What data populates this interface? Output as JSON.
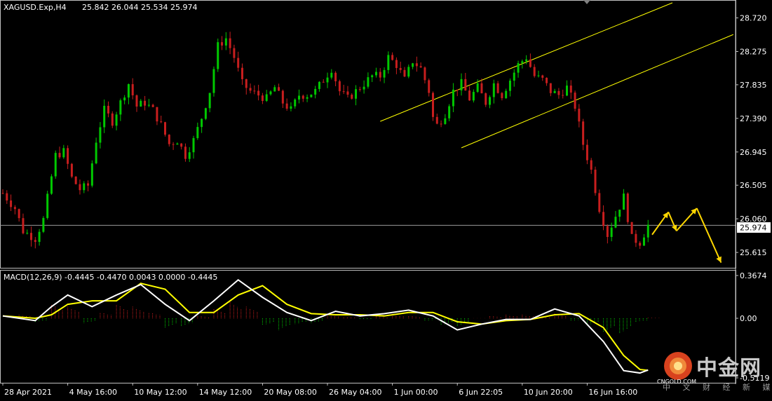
{
  "header": {
    "symbol_tf": "XAGUSD.Exp,H4",
    "ohlc": "25.842 26.044 25.534 25.974"
  },
  "price_axis": {
    "ticks": [
      "28.720",
      "28.275",
      "27.835",
      "27.390",
      "26.945",
      "26.505",
      "26.060",
      "25.615"
    ],
    "current_price": "25.974"
  },
  "macd": {
    "header": "MACD(12,26,9) -0.4445 -0.4470 0.0043 0.0000 -0.4445",
    "ticks": [
      "0.3674",
      "0.00",
      "-0.5119"
    ]
  },
  "time_axis": {
    "labels": [
      "28 Apr 2021",
      "4 May 16:00",
      "10 May 12:00",
      "14 May 12:00",
      "20 May 08:00",
      "26 May 04:00",
      "1 Jun 00:00",
      "6 Jun 22:05",
      "10 Jun 20:00",
      "16 Jun 16:00"
    ]
  },
  "watermark": {
    "name": "中金网",
    "url": "CNGOLD.COM",
    "sub": "中 文 财 经 新 媒 体"
  },
  "colors": {
    "background": "#000000",
    "bull": "#00c800",
    "bear": "#c81e1e",
    "channel": "#ffff00",
    "macd_line": "#ffffff",
    "signal_line": "#ffff00",
    "projection": "#ffd700",
    "grid": "#c0c0c0"
  },
  "chart_data": {
    "type": "candlestick",
    "symbol": "XAGUSD.Exp",
    "timeframe": "H4",
    "current_price": 25.974,
    "last_bar": {
      "open": 25.842,
      "high": 26.044,
      "low": 25.534,
      "close": 25.974
    },
    "y_range": [
      25.43,
      28.92
    ],
    "close_path": [
      {
        "t": 0,
        "c": 26.4
      },
      {
        "t": 3,
        "c": 26.2
      },
      {
        "t": 5,
        "c": 25.9
      },
      {
        "t": 8,
        "c": 25.8
      },
      {
        "t": 10,
        "c": 26.05
      },
      {
        "t": 13,
        "c": 26.9
      },
      {
        "t": 15,
        "c": 26.95
      },
      {
        "t": 17,
        "c": 26.6
      },
      {
        "t": 19,
        "c": 26.45
      },
      {
        "t": 21,
        "c": 26.5
      },
      {
        "t": 23,
        "c": 27.1
      },
      {
        "t": 25,
        "c": 27.5
      },
      {
        "t": 27,
        "c": 27.35
      },
      {
        "t": 29,
        "c": 27.6
      },
      {
        "t": 31,
        "c": 27.85
      },
      {
        "t": 33,
        "c": 27.55
      },
      {
        "t": 35,
        "c": 27.6
      },
      {
        "t": 37,
        "c": 27.5
      },
      {
        "t": 39,
        "c": 27.3
      },
      {
        "t": 41,
        "c": 27.05
      },
      {
        "t": 43,
        "c": 27.1
      },
      {
        "t": 45,
        "c": 26.9
      },
      {
        "t": 47,
        "c": 27.1
      },
      {
        "t": 49,
        "c": 27.4
      },
      {
        "t": 51,
        "c": 27.75
      },
      {
        "t": 53,
        "c": 28.35
      },
      {
        "t": 55,
        "c": 28.45
      },
      {
        "t": 57,
        "c": 28.2
      },
      {
        "t": 59,
        "c": 27.85
      },
      {
        "t": 61,
        "c": 27.75
      },
      {
        "t": 63,
        "c": 27.7
      },
      {
        "t": 65,
        "c": 27.65
      },
      {
        "t": 67,
        "c": 27.8
      },
      {
        "t": 69,
        "c": 27.6
      },
      {
        "t": 71,
        "c": 27.5
      },
      {
        "t": 73,
        "c": 27.7
      },
      {
        "t": 75,
        "c": 27.7
      },
      {
        "t": 77,
        "c": 27.75
      },
      {
        "t": 79,
        "c": 27.9
      },
      {
        "t": 81,
        "c": 28.05
      },
      {
        "t": 83,
        "c": 27.75
      },
      {
        "t": 85,
        "c": 27.65
      },
      {
        "t": 87,
        "c": 27.75
      },
      {
        "t": 89,
        "c": 27.85
      },
      {
        "t": 91,
        "c": 27.95
      },
      {
        "t": 93,
        "c": 27.95
      },
      {
        "t": 95,
        "c": 28.2
      },
      {
        "t": 97,
        "c": 28.1
      },
      {
        "t": 99,
        "c": 27.9
      },
      {
        "t": 101,
        "c": 28.15
      },
      {
        "t": 103,
        "c": 28.05
      },
      {
        "t": 105,
        "c": 27.75
      },
      {
        "t": 106,
        "c": 27.4
      },
      {
        "t": 107,
        "c": 27.3
      },
      {
        "t": 109,
        "c": 27.45
      },
      {
        "t": 111,
        "c": 27.75
      },
      {
        "t": 113,
        "c": 27.85
      },
      {
        "t": 115,
        "c": 27.65
      },
      {
        "t": 117,
        "c": 27.8
      },
      {
        "t": 119,
        "c": 27.6
      },
      {
        "t": 121,
        "c": 27.85
      },
      {
        "t": 123,
        "c": 27.7
      },
      {
        "t": 125,
        "c": 27.9
      },
      {
        "t": 127,
        "c": 28.1
      },
      {
        "t": 129,
        "c": 28.2
      },
      {
        "t": 131,
        "c": 27.95
      },
      {
        "t": 133,
        "c": 27.9
      },
      {
        "t": 135,
        "c": 27.75
      },
      {
        "t": 137,
        "c": 27.7
      },
      {
        "t": 139,
        "c": 27.8
      },
      {
        "t": 141,
        "c": 27.55
      },
      {
        "t": 143,
        "c": 27.05
      },
      {
        "t": 145,
        "c": 26.7
      },
      {
        "t": 147,
        "c": 26.2
      },
      {
        "t": 149,
        "c": 25.85
      },
      {
        "t": 151,
        "c": 26.1
      },
      {
        "t": 153,
        "c": 26.35
      },
      {
        "t": 155,
        "c": 25.8
      },
      {
        "t": 157,
        "c": 25.75
      },
      {
        "t": 159,
        "c": 25.974
      }
    ],
    "channel_upper": [
      {
        "t": 93,
        "c": 27.35
      },
      {
        "t": 165,
        "c": 28.92
      }
    ],
    "channel_lower": [
      {
        "t": 113,
        "c": 27.0
      },
      {
        "t": 180,
        "c": 28.5
      }
    ],
    "projection_path": [
      {
        "t": 160,
        "c": 25.85
      },
      {
        "t": 164,
        "c": 26.15
      },
      {
        "t": 166,
        "c": 25.9
      },
      {
        "t": 171,
        "c": 26.2
      },
      {
        "t": 177,
        "c": 25.48
      }
    ],
    "macd": {
      "y_range": [
        -0.5119,
        0.3674
      ],
      "values": [
        {
          "t": 0,
          "macd": 0.02,
          "signal": 0.02
        },
        {
          "t": 8,
          "macd": -0.02,
          "signal": 0.0
        },
        {
          "t": 12,
          "macd": 0.1,
          "signal": 0.03
        },
        {
          "t": 16,
          "macd": 0.2,
          "signal": 0.12
        },
        {
          "t": 22,
          "macd": 0.1,
          "signal": 0.15
        },
        {
          "t": 28,
          "macd": 0.2,
          "signal": 0.15
        },
        {
          "t": 34,
          "macd": 0.29,
          "signal": 0.3
        },
        {
          "t": 40,
          "macd": 0.12,
          "signal": 0.25
        },
        {
          "t": 46,
          "macd": -0.02,
          "signal": 0.05
        },
        {
          "t": 52,
          "macd": 0.15,
          "signal": 0.05
        },
        {
          "t": 58,
          "macd": 0.33,
          "signal": 0.2
        },
        {
          "t": 64,
          "macd": 0.18,
          "signal": 0.28
        },
        {
          "t": 70,
          "macd": 0.05,
          "signal": 0.12
        },
        {
          "t": 76,
          "macd": -0.02,
          "signal": 0.04
        },
        {
          "t": 82,
          "macd": 0.06,
          "signal": 0.03
        },
        {
          "t": 88,
          "macd": 0.02,
          "signal": 0.03
        },
        {
          "t": 94,
          "macd": 0.04,
          "signal": 0.02
        },
        {
          "t": 100,
          "macd": 0.07,
          "signal": 0.05
        },
        {
          "t": 106,
          "macd": 0.02,
          "signal": 0.05
        },
        {
          "t": 112,
          "macd": -0.1,
          "signal": -0.03
        },
        {
          "t": 118,
          "macd": -0.05,
          "signal": -0.05
        },
        {
          "t": 124,
          "macd": -0.01,
          "signal": -0.02
        },
        {
          "t": 130,
          "macd": -0.01,
          "signal": -0.01
        },
        {
          "t": 136,
          "macd": 0.08,
          "signal": 0.03
        },
        {
          "t": 142,
          "macd": 0.02,
          "signal": 0.04
        },
        {
          "t": 148,
          "macd": -0.2,
          "signal": -0.08
        },
        {
          "t": 153,
          "macd": -0.45,
          "signal": -0.32
        },
        {
          "t": 157,
          "macd": -0.47,
          "signal": -0.44
        },
        {
          "t": 159,
          "macd": -0.4445,
          "signal": -0.447
        }
      ],
      "histogram": [
        {
          "t": 4,
          "v": 0.03
        },
        {
          "t": 8,
          "v": -0.03
        },
        {
          "t": 12,
          "v": 0.12
        },
        {
          "t": 16,
          "v": 0.1
        },
        {
          "t": 20,
          "v": -0.04
        },
        {
          "t": 24,
          "v": 0.05
        },
        {
          "t": 28,
          "v": 0.12
        },
        {
          "t": 32,
          "v": 0.1
        },
        {
          "t": 36,
          "v": 0.05
        },
        {
          "t": 40,
          "v": -0.08
        },
        {
          "t": 44,
          "v": -0.07
        },
        {
          "t": 48,
          "v": 0.02
        },
        {
          "t": 52,
          "v": 0.08
        },
        {
          "t": 56,
          "v": 0.14
        },
        {
          "t": 60,
          "v": 0.1
        },
        {
          "t": 64,
          "v": -0.06
        },
        {
          "t": 68,
          "v": -0.1
        },
        {
          "t": 72,
          "v": -0.05
        },
        {
          "t": 76,
          "v": -0.04
        },
        {
          "t": 80,
          "v": 0.03
        },
        {
          "t": 84,
          "v": 0.01
        },
        {
          "t": 88,
          "v": -0.01
        },
        {
          "t": 92,
          "v": 0.02
        },
        {
          "t": 96,
          "v": 0.03
        },
        {
          "t": 100,
          "v": 0.02
        },
        {
          "t": 104,
          "v": -0.02
        },
        {
          "t": 108,
          "v": -0.06
        },
        {
          "t": 112,
          "v": -0.07
        },
        {
          "t": 116,
          "v": 0.0
        },
        {
          "t": 120,
          "v": 0.02
        },
        {
          "t": 124,
          "v": 0.03
        },
        {
          "t": 128,
          "v": 0.03
        },
        {
          "t": 132,
          "v": 0.02
        },
        {
          "t": 136,
          "v": 0.04
        },
        {
          "t": 140,
          "v": -0.02
        },
        {
          "t": 144,
          "v": -0.06
        },
        {
          "t": 148,
          "v": -0.12
        },
        {
          "t": 152,
          "v": -0.13
        },
        {
          "t": 156,
          "v": -0.03
        },
        {
          "t": 159,
          "v": 0.0043
        }
      ]
    }
  }
}
